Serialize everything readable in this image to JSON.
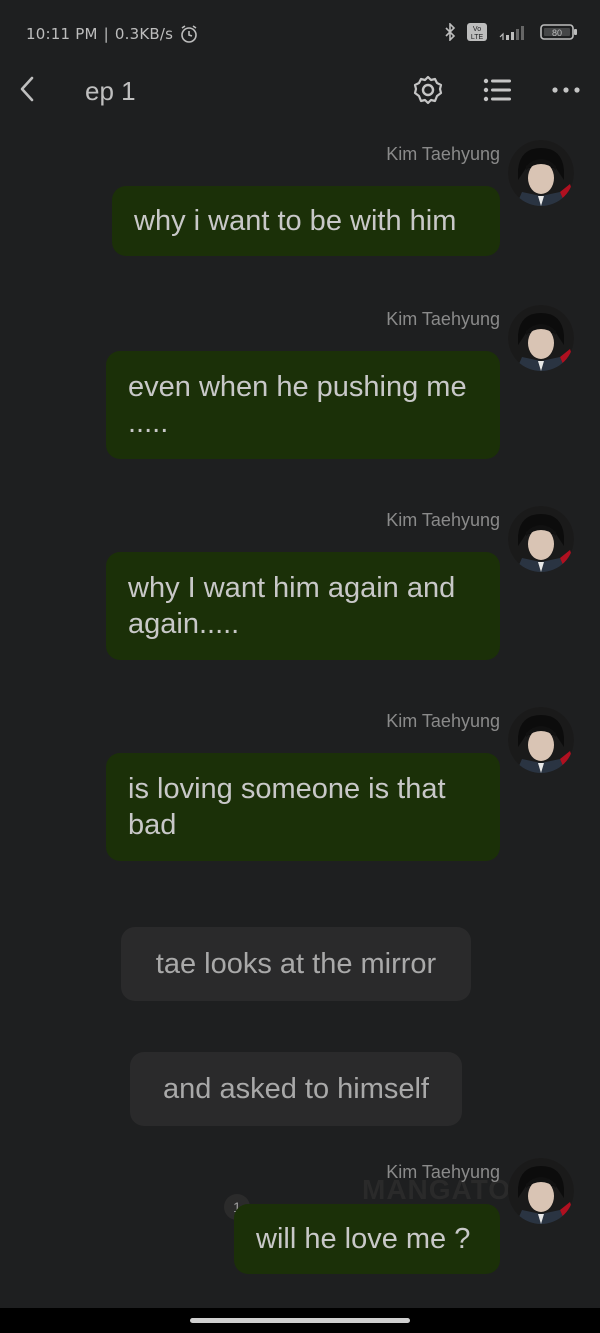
{
  "status_bar": {
    "time": "10:11 PM",
    "network_speed": "0.3KB/s",
    "battery_level": "80",
    "lte_label": "LTE",
    "vo_label": "Vo"
  },
  "header": {
    "title": "ep 1"
  },
  "messages": [
    {
      "sender": "Kim Taehyung",
      "text": "why i want to be with him"
    },
    {
      "sender": "Kim Taehyung",
      "text": "even when he pushing me ....."
    },
    {
      "sender": "Kim Taehyung",
      "text": "why I want him again and again....."
    },
    {
      "sender": "Kim Taehyung",
      "text": "is loving someone is that bad"
    }
  ],
  "narrations": [
    "tae looks at the mirror",
    "and asked to himself"
  ],
  "last_message": {
    "sender": "Kim Taehyung",
    "text": "will he love me ?",
    "badge": "1"
  },
  "watermark": "MANGATO",
  "colors": {
    "background": "#1e1f20",
    "bubble": "#1b3008",
    "narration": "#2a2a2b"
  }
}
